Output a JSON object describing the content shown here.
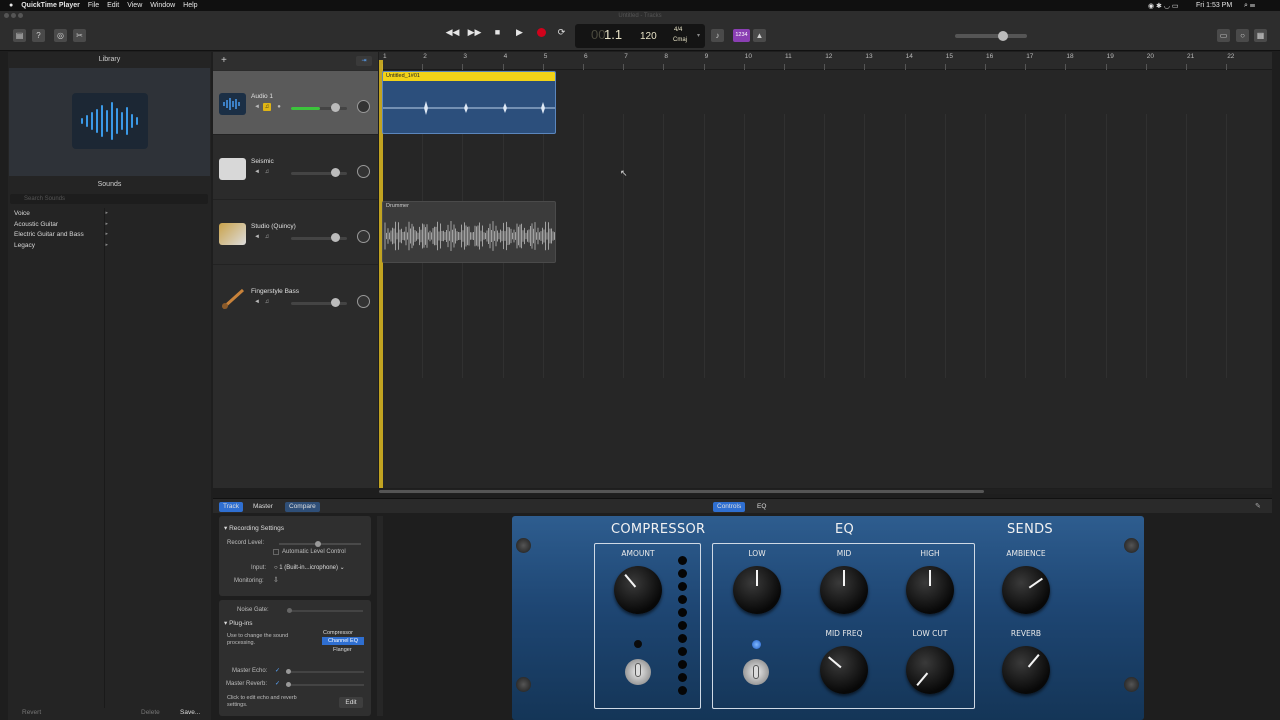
{
  "menubar": {
    "app_name": "QuickTime Player",
    "menus": [
      "File",
      "Edit",
      "View",
      "Window",
      "Help"
    ],
    "clock": "Fri 1:53 PM"
  },
  "window": {
    "title": "Untitled - Tracks"
  },
  "lcd": {
    "position_prefix": "00",
    "position": "1.1",
    "beat_label": "beat",
    "tempo": "120",
    "signature": "4/4",
    "key": "Cmaj"
  },
  "toolbar": {
    "count_in": "1234"
  },
  "library": {
    "title": "Library",
    "sounds_title": "Sounds",
    "search_placeholder": "Search Sounds",
    "categories": [
      "Voice",
      "Acoustic Guitar",
      "Electric Guitar and Bass",
      "Legacy"
    ],
    "revert": "Revert",
    "delete": "Delete",
    "save": "Save..."
  },
  "tracks": [
    {
      "name": "Audio 1",
      "volume_level": 0.75
    },
    {
      "name": "Seismic",
      "volume_level": 0.75
    },
    {
      "name": "Studio (Quincy)",
      "volume_level": 0.75
    },
    {
      "name": "Fingerstyle Bass",
      "volume_level": 0.75
    }
  ],
  "ruler": [
    "1",
    "2",
    "3",
    "4",
    "5",
    "6",
    "7",
    "8",
    "9",
    "10",
    "11",
    "12",
    "13",
    "14",
    "15",
    "16",
    "17",
    "18",
    "19",
    "20",
    "21",
    "22"
  ],
  "regions": {
    "audio_region": "Untitled_1#01",
    "drummer_region": "Drummer"
  },
  "bottom_tabs": {
    "track": "Track",
    "master": "Master",
    "compare": "Compare",
    "controls": "Controls",
    "eq": "EQ"
  },
  "smart": {
    "recording_settings": "Recording Settings",
    "record_level": "Record Level:",
    "auto_level": "Automatic Level Control",
    "input_label": "Input:",
    "input_value": "1 (Built-in...icrophone)",
    "monitoring": "Monitoring:",
    "noise_gate": "Noise Gate:",
    "plugins": "Plug-ins",
    "plugins_desc": "Use to change the sound processing.",
    "plugin_list": [
      "Compressor",
      "Channel EQ",
      "Flanger"
    ],
    "master_echo": "Master Echo:",
    "master_reverb": "Master Reverb:",
    "click_edit": "Click to edit echo and reverb settings.",
    "edit": "Edit"
  },
  "plugin_panel": {
    "compressor": "COMPRESSOR",
    "eq": "EQ",
    "sends": "SENDS",
    "amount": "AMOUNT",
    "low": "LOW",
    "mid": "MID",
    "high": "HIGH",
    "ambience": "AMBIENCE",
    "mid_freq": "MID FREQ",
    "low_cut": "LOW CUT",
    "reverb": "REVERB"
  },
  "colors": {
    "accent": "#2f6fd1",
    "region_yellow": "#f2d318",
    "region_blue": "#2c4f7c",
    "record_red": "#d0021b"
  }
}
